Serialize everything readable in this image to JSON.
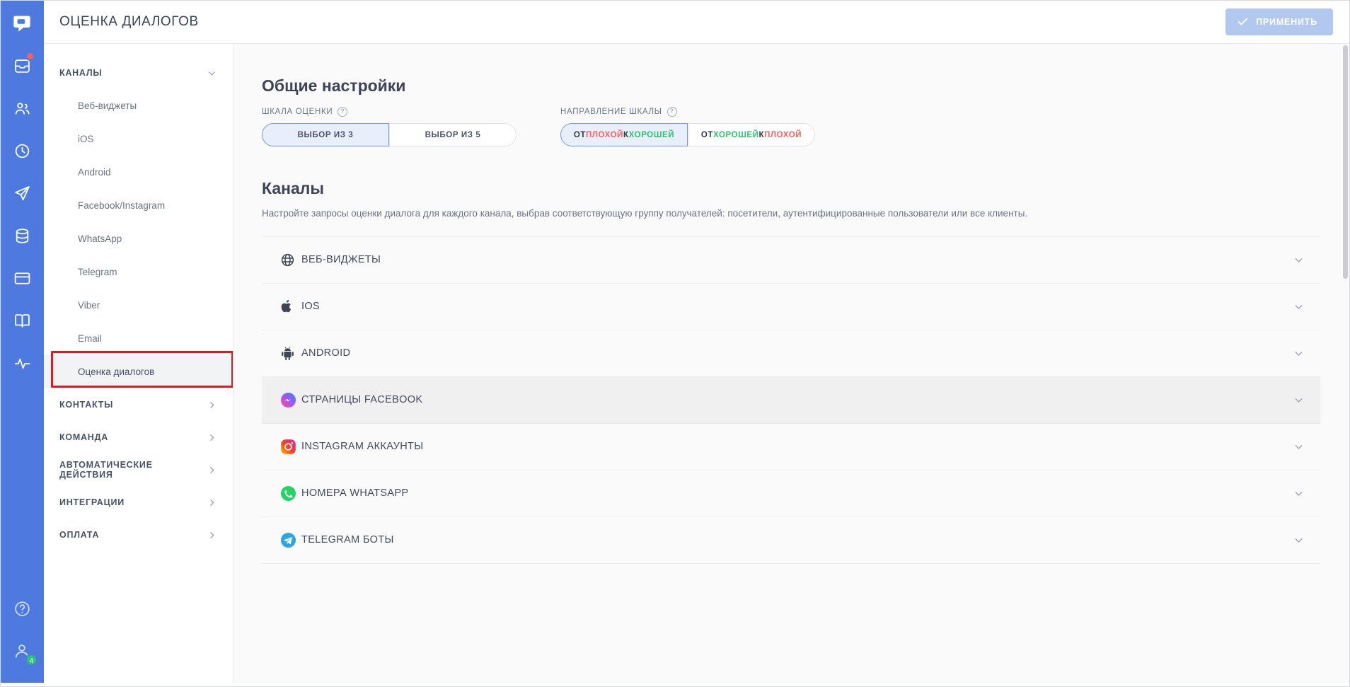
{
  "rail": {
    "items": [
      {
        "name": "chat-logo",
        "badge": null
      },
      {
        "name": "inbox",
        "badge_dot": true
      },
      {
        "name": "contacts",
        "badge": null
      },
      {
        "name": "history",
        "badge": null
      },
      {
        "name": "broadcast",
        "badge": null
      },
      {
        "name": "database",
        "badge": null
      },
      {
        "name": "cards",
        "badge": null
      },
      {
        "name": "knowledge-base",
        "badge": null
      },
      {
        "name": "analytics",
        "badge": null
      }
    ],
    "bottom": [
      {
        "name": "help",
        "badge": null
      },
      {
        "name": "profile",
        "badge": "4"
      }
    ]
  },
  "header": {
    "title": "ОЦЕНКА ДИАЛОГОВ",
    "apply_label": "ПРИМЕНИТЬ"
  },
  "sidebar": {
    "groups": [
      {
        "label": "КАНАЛЫ",
        "expanded": true,
        "chevron": "chevron-down"
      },
      {
        "label": "КОНТАКТЫ",
        "expanded": false,
        "chevron": "chevron-right"
      },
      {
        "label": "КОМАНДА",
        "expanded": false,
        "chevron": "chevron-right"
      },
      {
        "label": "АВТОМАТИЧЕСКИЕ ДЕЙСТВИЯ",
        "expanded": false,
        "chevron": "chevron-right"
      },
      {
        "label": "ИНТЕГРАЦИИ",
        "expanded": false,
        "chevron": "chevron-right"
      },
      {
        "label": "ОПЛАТА",
        "expanded": false,
        "chevron": "chevron-right"
      }
    ],
    "channel_items": [
      {
        "label": "Веб-виджеты",
        "active": false
      },
      {
        "label": "iOS",
        "active": false
      },
      {
        "label": "Android",
        "active": false
      },
      {
        "label": "Facebook/Instagram",
        "active": false
      },
      {
        "label": "WhatsApp",
        "active": false
      },
      {
        "label": "Telegram",
        "active": false
      },
      {
        "label": "Viber",
        "active": false
      },
      {
        "label": "Email",
        "active": false
      },
      {
        "label": "Оценка диалогов",
        "active": true
      }
    ],
    "annotation_target": "Оценка диалогов",
    "annotation_color": "#e01b1b"
  },
  "main": {
    "general": {
      "heading": "Общие настройки",
      "scale_label": "ШКАЛА ОЦЕНКИ",
      "scale_options": [
        {
          "label": "ВЫБОР ИЗ 3",
          "selected": true
        },
        {
          "label": "ВЫБОР ИЗ 5",
          "selected": false
        }
      ],
      "direction_label": "НАПРАВЛЕНИЕ ШКАЛЫ",
      "direction_options": [
        {
          "selected": true,
          "parts": [
            {
              "text": "ОТ ",
              "tone": "neutral"
            },
            {
              "text": "ПЛОХОЙ",
              "tone": "bad"
            },
            {
              "text": " К ",
              "tone": "neutral"
            },
            {
              "text": "ХОРОШЕЙ",
              "tone": "good"
            }
          ]
        },
        {
          "selected": false,
          "parts": [
            {
              "text": "ОТ ",
              "tone": "neutral"
            },
            {
              "text": "ХОРОШЕЙ",
              "tone": "good"
            },
            {
              "text": " К ",
              "tone": "neutral"
            },
            {
              "text": "ПЛОХОЙ",
              "tone": "bad"
            }
          ]
        }
      ]
    },
    "channels": {
      "heading": "Каналы",
      "description": "Настройте запросы оценки диалога для каждого канала, выбрав соответствующую группу получателей: посетители, аутентифицированные пользователи или все клиенты.",
      "rows": [
        {
          "label": "ВЕБ-ВИДЖЕТЫ",
          "icon": "globe-icon",
          "highlighted": false
        },
        {
          "label": "IOS",
          "icon": "apple-icon",
          "highlighted": false
        },
        {
          "label": "ANDROID",
          "icon": "android-icon",
          "highlighted": false
        },
        {
          "label": "СТРАНИЦЫ FACEBOOK",
          "icon": "messenger-icon",
          "highlighted": true
        },
        {
          "label": "INSTAGRAM АККАУНТЫ",
          "icon": "instagram-icon",
          "highlighted": false
        },
        {
          "label": "НОМЕРА WHATSAPP",
          "icon": "whatsapp-icon",
          "highlighted": false
        },
        {
          "label": "TELEGRAM БОТЫ",
          "icon": "telegram-icon",
          "highlighted": false
        }
      ]
    }
  },
  "colors": {
    "rail": "#4e7ae0",
    "accent": "#4e7ae0",
    "bad": "#f4615f",
    "good": "#2fc06a",
    "annotation": "#e01b1b",
    "apply_button": "#b3c8ee"
  }
}
